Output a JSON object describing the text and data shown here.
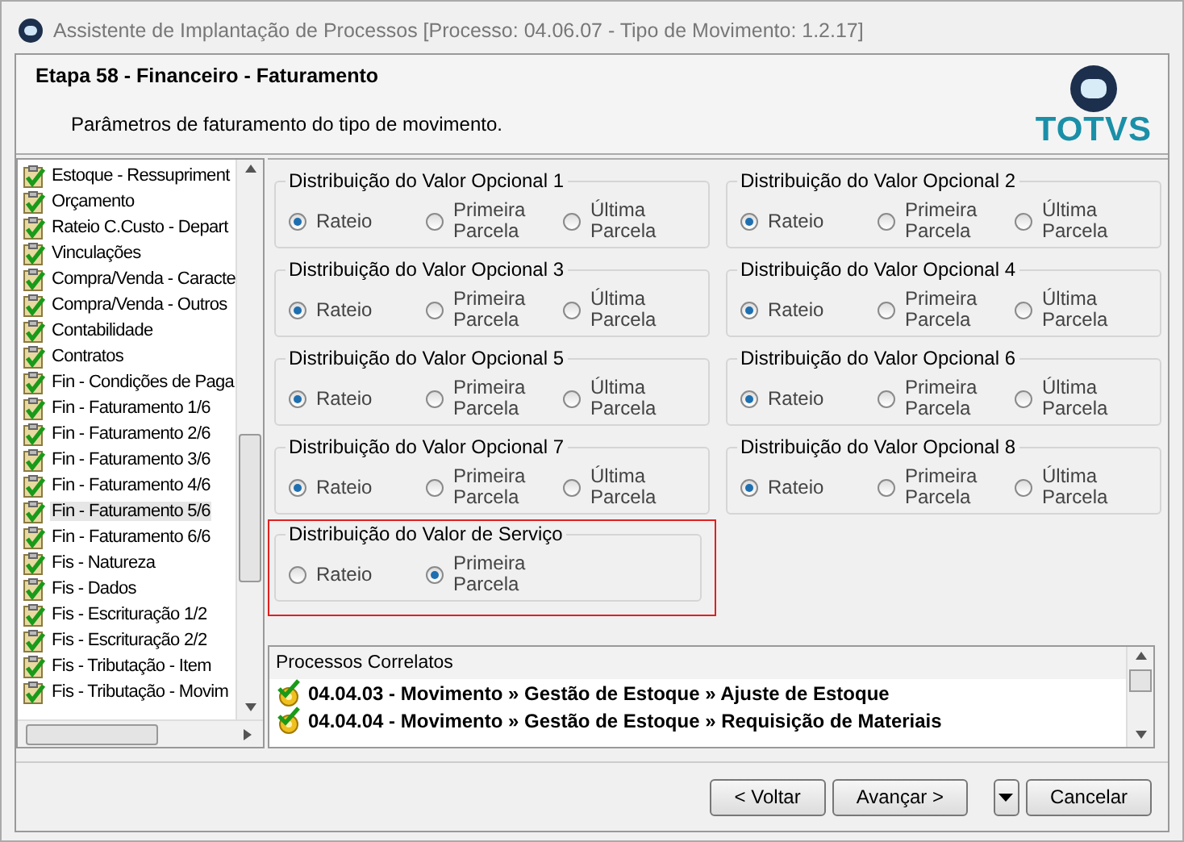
{
  "window": {
    "title": "Assistente de Implantação de Processos [Processo: 04.06.07 - Tipo de Movimento: 1.2.17]"
  },
  "header": {
    "title": "Etapa 58 - Financeiro - Faturamento",
    "subtitle": "Parâmetros de faturamento do tipo de movimento.",
    "logo_text": "TOTVS"
  },
  "steps": [
    {
      "label": "Estoque - Ressupriment",
      "selected": false
    },
    {
      "label": "Orçamento",
      "selected": false
    },
    {
      "label": "Rateio C.Custo - Depart",
      "selected": false
    },
    {
      "label": "Vinculações",
      "selected": false
    },
    {
      "label": "Compra/Venda - Caracte",
      "selected": false
    },
    {
      "label": "Compra/Venda - Outros",
      "selected": false
    },
    {
      "label": "Contabilidade",
      "selected": false
    },
    {
      "label": "Contratos",
      "selected": false
    },
    {
      "label": "Fin - Condições de Paga",
      "selected": false
    },
    {
      "label": "Fin - Faturamento 1/6",
      "selected": false
    },
    {
      "label": "Fin - Faturamento 2/6",
      "selected": false
    },
    {
      "label": "Fin - Faturamento 3/6",
      "selected": false
    },
    {
      "label": "Fin - Faturamento 4/6",
      "selected": false
    },
    {
      "label": "Fin - Faturamento 5/6",
      "selected": true
    },
    {
      "label": "Fin - Faturamento 6/6",
      "selected": false
    },
    {
      "label": "Fis - Natureza",
      "selected": false
    },
    {
      "label": "Fis - Dados",
      "selected": false
    },
    {
      "label": "Fis - Escrituração 1/2",
      "selected": false
    },
    {
      "label": "Fis - Escrituração 2/2",
      "selected": false
    },
    {
      "label": "Fis - Tributação - Item",
      "selected": false
    },
    {
      "label": "Fis - Tributação - Movim",
      "selected": false
    }
  ],
  "groups": [
    {
      "title": "Distribuição do Valor Opcional 1",
      "highlighted": false,
      "options": [
        {
          "label": "Rateio",
          "selected": true
        },
        {
          "label": "Primeira Parcela",
          "selected": false
        },
        {
          "label": "Última Parcela",
          "selected": false
        }
      ]
    },
    {
      "title": "Distribuição do Valor Opcional 2",
      "highlighted": false,
      "options": [
        {
          "label": "Rateio",
          "selected": true
        },
        {
          "label": "Primeira Parcela",
          "selected": false
        },
        {
          "label": "Última Parcela",
          "selected": false
        }
      ]
    },
    {
      "title": "Distribuição do Valor Opcional 3",
      "highlighted": false,
      "options": [
        {
          "label": "Rateio",
          "selected": true
        },
        {
          "label": "Primeira Parcela",
          "selected": false
        },
        {
          "label": "Última Parcela",
          "selected": false
        }
      ]
    },
    {
      "title": "Distribuição do Valor Opcional 4",
      "highlighted": false,
      "options": [
        {
          "label": "Rateio",
          "selected": true
        },
        {
          "label": "Primeira Parcela",
          "selected": false
        },
        {
          "label": "Última Parcela",
          "selected": false
        }
      ]
    },
    {
      "title": "Distribuição do Valor Opcional 5",
      "highlighted": false,
      "options": [
        {
          "label": "Rateio",
          "selected": true
        },
        {
          "label": "Primeira Parcela",
          "selected": false
        },
        {
          "label": "Última Parcela",
          "selected": false
        }
      ]
    },
    {
      "title": "Distribuição do Valor Opcional 6",
      "highlighted": false,
      "options": [
        {
          "label": "Rateio",
          "selected": true
        },
        {
          "label": "Primeira Parcela",
          "selected": false
        },
        {
          "label": "Última Parcela",
          "selected": false
        }
      ]
    },
    {
      "title": "Distribuição do Valor Opcional 7",
      "highlighted": false,
      "options": [
        {
          "label": "Rateio",
          "selected": true
        },
        {
          "label": "Primeira Parcela",
          "selected": false
        },
        {
          "label": "Última Parcela",
          "selected": false
        }
      ]
    },
    {
      "title": "Distribuição do Valor Opcional 8",
      "highlighted": false,
      "options": [
        {
          "label": "Rateio",
          "selected": true
        },
        {
          "label": "Primeira Parcela",
          "selected": false
        },
        {
          "label": "Última Parcela",
          "selected": false
        }
      ]
    },
    {
      "title": "Distribuição do Valor  de Serviço",
      "highlighted": true,
      "options": [
        {
          "label": "Rateio",
          "selected": false
        },
        {
          "label": "Primeira Parcela",
          "selected": true
        }
      ]
    }
  ],
  "related": {
    "title": "Processos Correlatos",
    "items": [
      "04.04.03 - Movimento » Gestão de Estoque » Ajuste de Estoque",
      "04.04.04 - Movimento » Gestão de Estoque » Requisição de Materiais"
    ]
  },
  "buttons": [
    "< Voltar",
    "Avançar >",
    "Cancelar"
  ]
}
